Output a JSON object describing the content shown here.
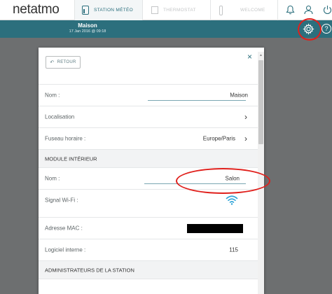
{
  "nav": {
    "logo_main": "net",
    "logo_tail": "atmo",
    "tabs": [
      {
        "label": "STATION MÉTÉO",
        "icon": "weather-station-icon",
        "active": true
      },
      {
        "label": "THERMOSTAT",
        "icon": "thermostat-icon",
        "active": false
      },
      {
        "label": "WELCOME",
        "icon": "welcome-camera-icon",
        "active": false
      }
    ],
    "right_icons": [
      "bell-icon",
      "user-icon",
      "power-icon"
    ]
  },
  "header": {
    "title": "Maison",
    "date": "17 Jan 2016 @ 09:18",
    "help_glyph": "?"
  },
  "modal": {
    "back_label": "RETOUR",
    "close_glyph": "×",
    "rows": [
      {
        "label": "Nom :",
        "value": "Maison"
      },
      {
        "label": "Localisation",
        "value": "›"
      },
      {
        "label": "Fuseau horaire :",
        "value": "Europe/Paris",
        "chevron": "›"
      },
      {
        "label": "MODULE INTÉRIEUR"
      },
      {
        "label": "Nom :",
        "value": "Salon"
      },
      {
        "label": "Signal Wi-Fi :"
      },
      {
        "label": "Adresse MAC :"
      },
      {
        "label": "Logiciel interne :",
        "value": "115"
      },
      {
        "label": "ADMINISTRATEURS DE LA STATION"
      }
    ]
  },
  "colors": {
    "accent": "#2c6f7d",
    "annotation_red": "#e0201c",
    "wifi": "#2fa4d8"
  }
}
